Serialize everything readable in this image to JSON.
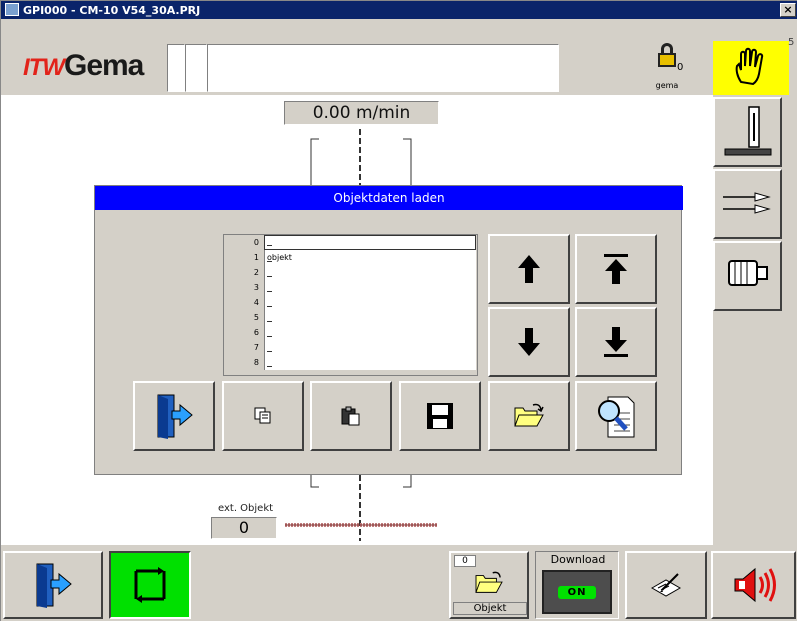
{
  "window": {
    "title": "GPI000 - CM-10 V54_30A.PRJ",
    "close_label": "×"
  },
  "header": {
    "logo_itw": "ITW",
    "logo_brand": "Gema",
    "lock_count": "0",
    "lock_label": "gema",
    "hand_count": "5"
  },
  "main": {
    "speed": "0.00 m/min",
    "ext_object_label": "ext. Objekt",
    "ext_object_value": "0"
  },
  "dialog": {
    "title": "Objektdaten laden",
    "rows": [
      {
        "num": "0",
        "name": ""
      },
      {
        "num": "1",
        "name": "objekt"
      },
      {
        "num": "2",
        "name": ""
      },
      {
        "num": "3",
        "name": ""
      },
      {
        "num": "4",
        "name": ""
      },
      {
        "num": "5",
        "name": ""
      },
      {
        "num": "6",
        "name": ""
      },
      {
        "num": "7",
        "name": ""
      },
      {
        "num": "8",
        "name": ""
      }
    ],
    "selected_row": 0
  },
  "bottom": {
    "objekt_count": "0",
    "objekt_label": "Objekt",
    "download_label": "Download",
    "download_state": "ON"
  },
  "colors": {
    "dialog_title_bg": "#0000ff",
    "hand_bg": "#ffff00",
    "green_button": "#00e000",
    "logo_red": "#e2231a"
  }
}
